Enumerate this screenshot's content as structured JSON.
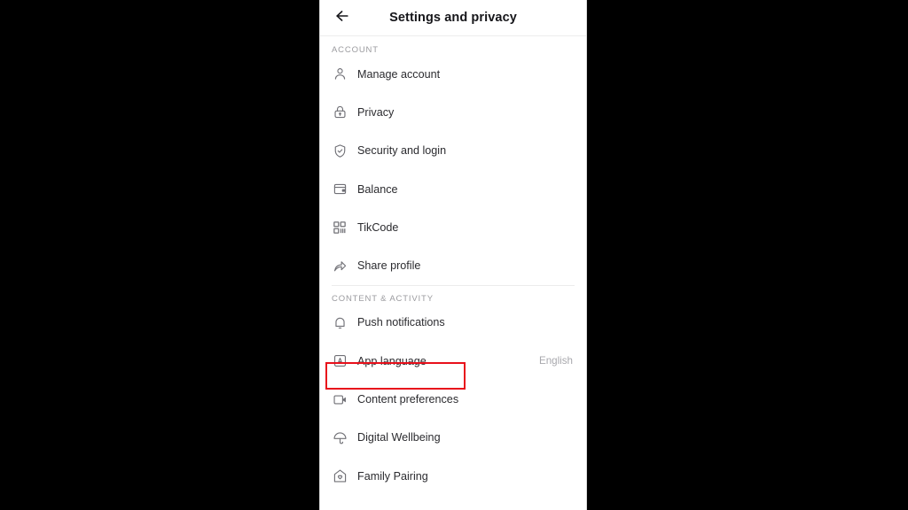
{
  "header": {
    "title": "Settings and privacy",
    "back_icon": "arrow-left-icon"
  },
  "sections": [
    {
      "id": "account",
      "label": "ACCOUNT",
      "items": [
        {
          "id": "manage-account",
          "label": "Manage account",
          "icon": "person-icon",
          "value": ""
        },
        {
          "id": "privacy",
          "label": "Privacy",
          "icon": "lock-icon",
          "value": ""
        },
        {
          "id": "security-login",
          "label": "Security and login",
          "icon": "shield-check-icon",
          "value": ""
        },
        {
          "id": "balance",
          "label": "Balance",
          "icon": "wallet-icon",
          "value": ""
        },
        {
          "id": "tikcode",
          "label": "TikCode",
          "icon": "qr-code-icon",
          "value": ""
        },
        {
          "id": "share-profile",
          "label": "Share profile",
          "icon": "share-arrow-icon",
          "value": ""
        }
      ]
    },
    {
      "id": "content-activity",
      "label": "CONTENT & ACTIVITY",
      "items": [
        {
          "id": "push-notifications",
          "label": "Push notifications",
          "icon": "bell-icon",
          "value": ""
        },
        {
          "id": "app-language",
          "label": "App language",
          "icon": "letter-a-icon",
          "value": "English"
        },
        {
          "id": "content-preferences",
          "label": "Content preferences",
          "icon": "video-camera-icon",
          "value": ""
        },
        {
          "id": "digital-wellbeing",
          "label": "Digital Wellbeing",
          "icon": "umbrella-icon",
          "value": ""
        },
        {
          "id": "family-pairing",
          "label": "Family Pairing",
          "icon": "house-heart-icon",
          "value": ""
        }
      ]
    }
  ],
  "annotation": {
    "target": "app-language",
    "color": "#e8101b"
  }
}
